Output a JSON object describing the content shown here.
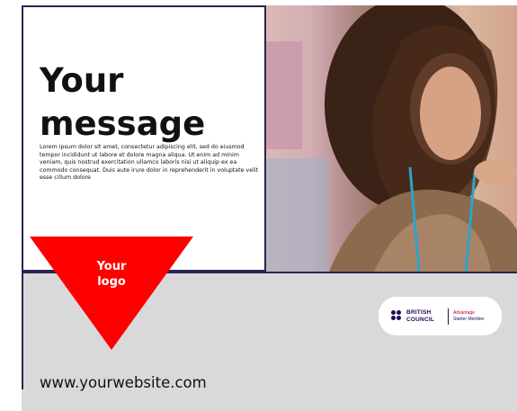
{
  "headline": {
    "line1": "Your",
    "line2": "message"
  },
  "body_text": "Lorem ipsum dolor sit amet, consectetur adipiscing elit, sed do eiusmod tempor incididunt ut labore et dolore magna aliqua. Ut enim ad minim veniam, quis nostrud exercitation ullamco laboris nisi ut aliquip ex ea commodo consequat. Duis aute irure dolor in reprehenderit in voluptate velit esse cillum dolore",
  "logo_placeholder": {
    "line1": "Your",
    "line2": "logo",
    "color": "#ff0000"
  },
  "badge": {
    "org_line1": "BRITISH",
    "org_line2": "COUNCIL",
    "tier_line1": "Advantage",
    "tier_line2": "Starter Member",
    "brand_color": "#23085a"
  },
  "website": "www.yourwebsite.com",
  "colors": {
    "frame": "#2a2550",
    "strip": "#d9d9d9",
    "accent": "#ff0000"
  }
}
